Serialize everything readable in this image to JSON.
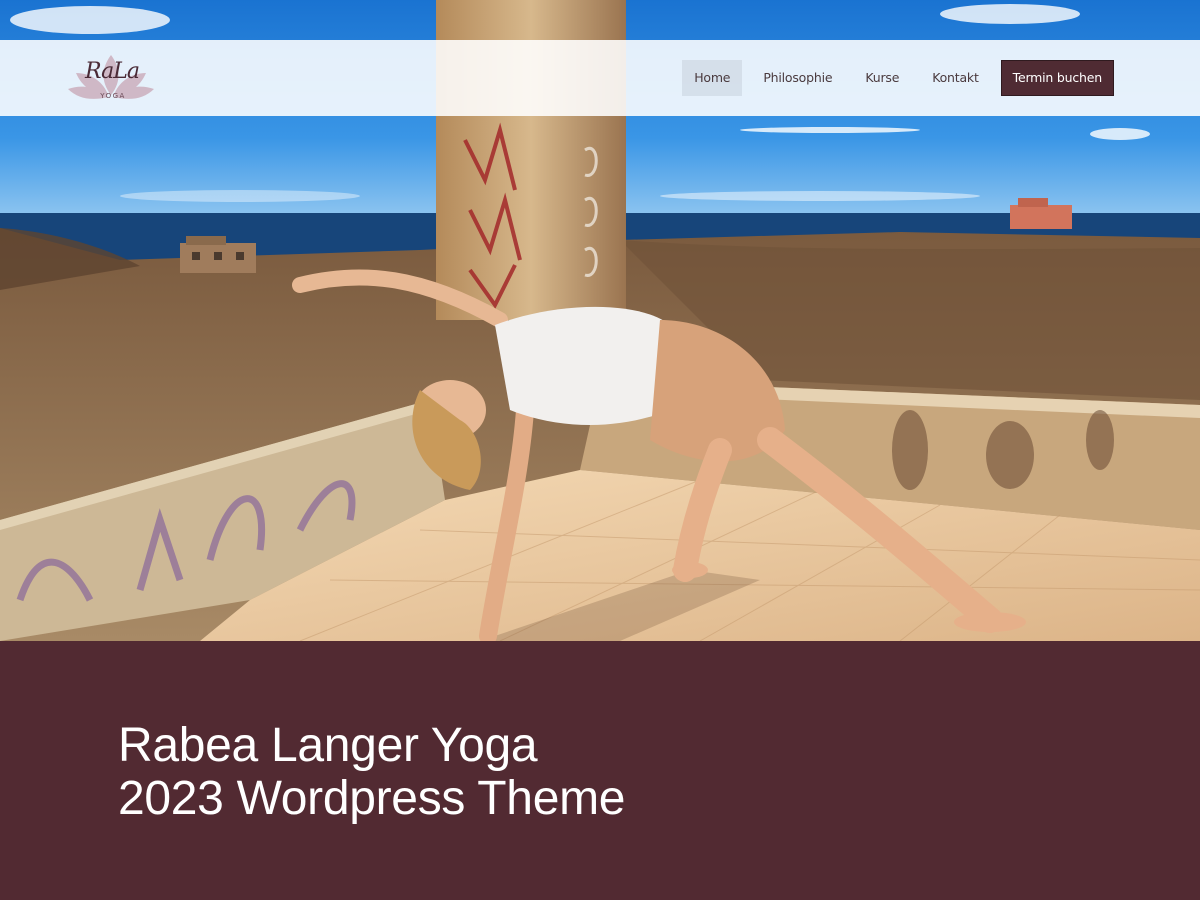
{
  "logo": {
    "brand_text": "RaLa",
    "sub_text": "YOGA",
    "icon": "lotus-icon"
  },
  "nav": {
    "items": [
      {
        "label": "Home",
        "active": true
      },
      {
        "label": "Philosophie",
        "active": false
      },
      {
        "label": "Kurse",
        "active": false
      },
      {
        "label": "Kontakt",
        "active": false
      }
    ],
    "cta_label": "Termin buchen"
  },
  "hero": {
    "image_description_icon": "hero-photo",
    "colors": {
      "sky": "#1e7fd6",
      "sea": "#17457a",
      "ground": "#8a6a4a",
      "wall": "#c9b08e",
      "floor": "#e8c49c"
    }
  },
  "panel": {
    "title_line1": "Rabea Langer Yoga",
    "title_line2": "2023 Wordpress Theme",
    "background": "#522a32"
  }
}
